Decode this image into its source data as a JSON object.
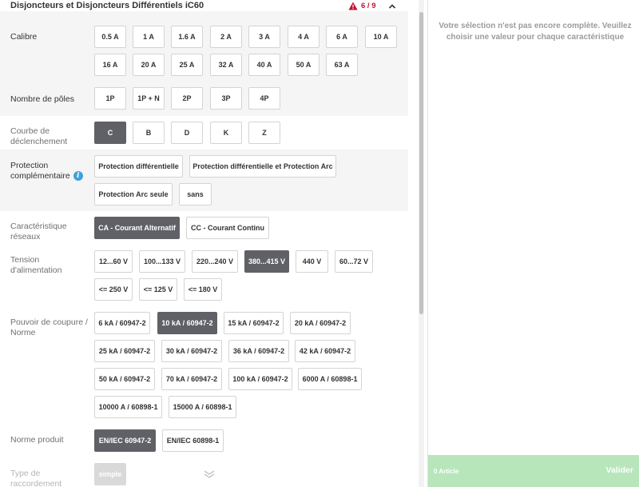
{
  "header": {
    "title": "Disjoncteurs et Disjoncteurs Différentiels iC60",
    "step_counter": "6 / 9"
  },
  "sections": [
    {
      "label": "Calibre",
      "options": [
        "0.5 A",
        "1 A",
        "1.6 A",
        "2 A",
        "3 A",
        "4 A",
        "6 A",
        "10 A",
        "16 A",
        "20 A",
        "25 A",
        "32 A",
        "40 A",
        "50 A",
        "63 A"
      ],
      "selected": null
    },
    {
      "label": "Nombre de pôles",
      "options": [
        "1P",
        "1P + N",
        "2P",
        "3P",
        "4P"
      ],
      "selected": null
    },
    {
      "label": "Courbe de déclenchement",
      "options": [
        "C",
        "B",
        "D",
        "K",
        "Z"
      ],
      "selected": "C"
    },
    {
      "label": "Protection complémentaire",
      "options": [
        "Protection différentielle",
        "Protection différentielle et Protection Arc",
        "Protection Arc seule",
        "sans"
      ],
      "selected": null
    },
    {
      "label": "Caractéristique réseaux",
      "options": [
        "CA - Courant Alternatif",
        "CC - Courant Continu"
      ],
      "selected": "CA - Courant Alternatif"
    },
    {
      "label": "Tension d'alimentation",
      "options": [
        "12...60 V",
        "100...133 V",
        "220...240 V",
        "380...415 V",
        "440 V",
        "60...72 V",
        "<= 250 V",
        "<= 125 V",
        "<= 180 V"
      ],
      "selected": "380...415 V"
    },
    {
      "label": "Pouvoir de coupure / Norme",
      "options": [
        "6 kA / 60947-2",
        "10 kA / 60947-2",
        "15 kA / 60947-2",
        "20 kA / 60947-2",
        "25 kA / 60947-2",
        "30 kA / 60947-2",
        "36 kA / 60947-2",
        "42 kA / 60947-2",
        "50 kA / 60947-2",
        "70 kA / 60947-2",
        "100 kA / 60947-2",
        "6000 A / 60898-1",
        "10000 A / 60898-1",
        "15000 A / 60898-1"
      ],
      "selected": "10 kA / 60947-2"
    },
    {
      "label": "Norme produit",
      "options": [
        "EN/IEC 60947-2",
        "EN/IEC 60898-1"
      ],
      "selected": "EN/IEC 60947-2"
    },
    {
      "label": "Type de raccordement",
      "options": [
        "simple"
      ],
      "selected": "simple"
    }
  ],
  "summary": {
    "message": "Votre sélection n'est pas encore complète. Veuillez choisir une valeur pour chaque caractéristique",
    "article_count": "0 Article",
    "validate_label": "Valider"
  },
  "colors": {
    "selected_bg": "#5f6166",
    "warning": "#c8102e",
    "info": "#3ea2db",
    "footer_bg": "#b7e6ba"
  }
}
